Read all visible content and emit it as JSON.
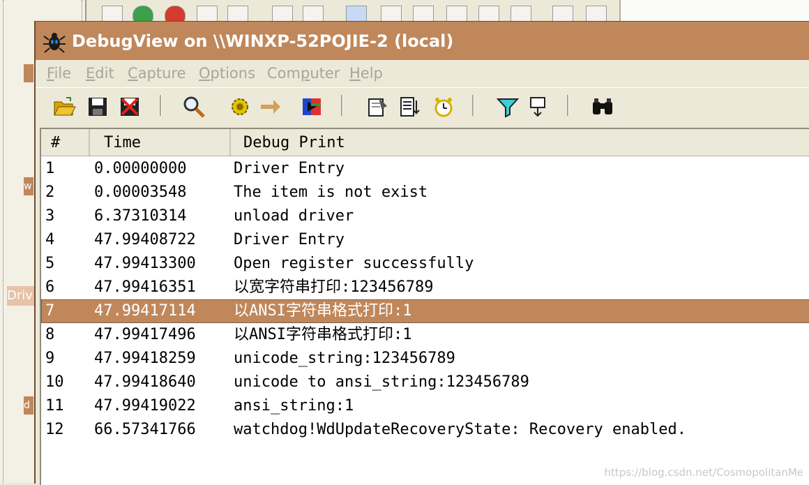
{
  "window": {
    "title": "DebugView on \\\\WINXP-52POJIE-2 (local)"
  },
  "menu": [
    {
      "label": "File",
      "u": "F",
      "rest": "ile"
    },
    {
      "label": "Edit",
      "u": "E",
      "rest": "dit"
    },
    {
      "label": "Capture",
      "u": "C",
      "rest": "apture"
    },
    {
      "label": "Options",
      "u": "O",
      "rest": "ptions"
    },
    {
      "label": "Computer",
      "pre": "Com",
      "u": "p",
      "rest": "uter"
    },
    {
      "label": "Help",
      "u": "H",
      "rest": "elp"
    }
  ],
  "toolbar_icons": [
    "open-folder-icon",
    "save-icon",
    "clear-display-icon",
    "find-icon",
    "capture-gear-icon",
    "autoscroll-arrow-icon",
    "highlight-icon",
    "copy-icon",
    "properties-icon",
    "clock-time-icon",
    "filter-icon",
    "history-depth-icon",
    "binoculars-icon"
  ],
  "columns": [
    "#",
    "Time",
    "Debug Print"
  ],
  "rows": [
    {
      "num": "1",
      "time": "0.00000000",
      "msg": "Driver Entry"
    },
    {
      "num": "2",
      "time": "0.00003548",
      "msg": "The item is not exist"
    },
    {
      "num": "3",
      "time": "6.37310314",
      "msg": "unload driver"
    },
    {
      "num": "4",
      "time": "47.99408722",
      "msg": "Driver Entry"
    },
    {
      "num": "5",
      "time": "47.99413300",
      "msg": "Open register successfully"
    },
    {
      "num": "6",
      "time": "47.99416351",
      "msg": "以宽字符串打印:123456789"
    },
    {
      "num": "7",
      "time": "47.99417114",
      "msg": "以ANSI字符串格式打印:1",
      "selected": true
    },
    {
      "num": "8",
      "time": "47.99417496",
      "msg": "以ANSI字符串格式打印:1"
    },
    {
      "num": "9",
      "time": "47.99418259",
      "msg": "unicode_string:123456789"
    },
    {
      "num": "10",
      "time": "47.99418640",
      "msg": "unicode to ansi_string:123456789"
    },
    {
      "num": "11",
      "time": "47.99419022",
      "msg": "ansi_string:1"
    },
    {
      "num": "12",
      "time": "66.57341766",
      "msg": "watchdog!WdUpdateRecoveryState: Recovery enabled."
    }
  ],
  "background": {
    "tag_w": "w",
    "tag_d": "d",
    "drv": "Driv"
  },
  "watermark": "https://blog.csdn.net/CosmopolitanMe",
  "colors": {
    "titlebar": "#c0875b",
    "selected_row": "#c0875b",
    "menu_disabled_text": "#a7a69c"
  }
}
